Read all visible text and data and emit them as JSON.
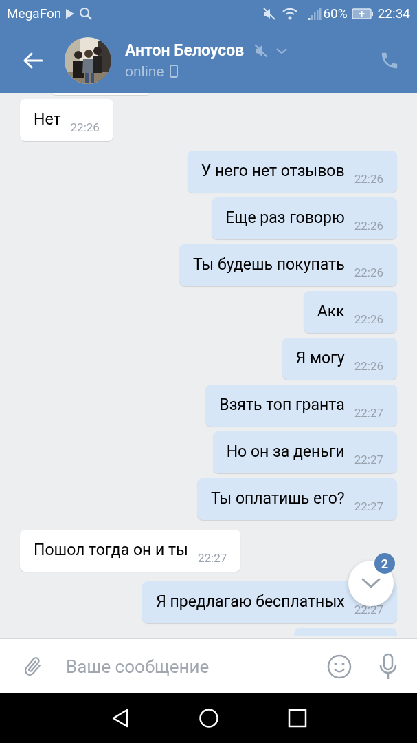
{
  "status_bar": {
    "carrier": "MegaFon",
    "battery": "60%",
    "time": "22:34"
  },
  "header": {
    "name": "Антон Белоусов",
    "muted": true,
    "presence": "online"
  },
  "messages": [
    {
      "kind": "incoming",
      "text": "Нет",
      "time": "22:26"
    },
    {
      "kind": "outgoing",
      "text": "У него нет отзывов",
      "time": "22:26"
    },
    {
      "kind": "outgoing",
      "text": "Еще раз говорю",
      "time": "22:26"
    },
    {
      "kind": "outgoing",
      "text": "Ты будешь покупать",
      "time": "22:26"
    },
    {
      "kind": "outgoing",
      "text": "Акк",
      "time": "22:26"
    },
    {
      "kind": "outgoing",
      "text": "Я могу",
      "time": "22:26"
    },
    {
      "kind": "outgoing",
      "text": "Взять топ гранта",
      "time": "22:27"
    },
    {
      "kind": "outgoing",
      "text": "Но он за деньги",
      "time": "22:27"
    },
    {
      "kind": "outgoing",
      "text": "Ты оплатишь его?",
      "time": "22:27"
    },
    {
      "kind": "incoming",
      "text": "Пошол тогда он и ты",
      "time": "22:27"
    },
    {
      "kind": "outgoing",
      "text": "Я предлагаю бесплатных",
      "time": "22:27"
    }
  ],
  "scroll_button": {
    "badge": "2"
  },
  "composer": {
    "placeholder": "Ваше сообщение"
  }
}
